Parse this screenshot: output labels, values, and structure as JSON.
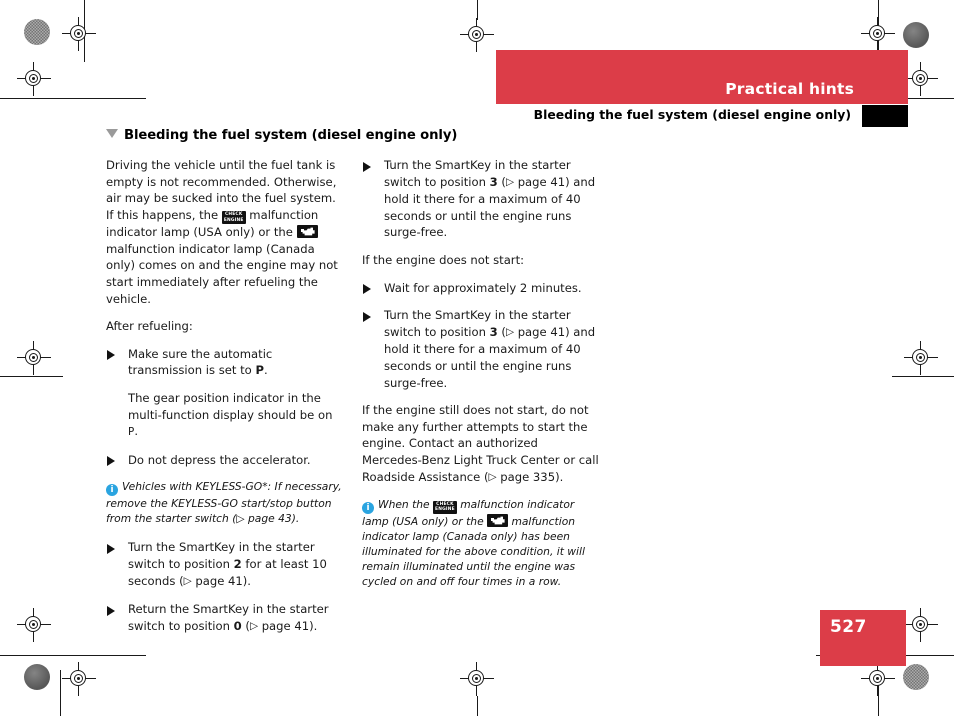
{
  "colors": {
    "brand_red": "#dc3d48",
    "info_blue": "#2aa4e0",
    "black": "#000000"
  },
  "header": {
    "banner_title": "Practical hints",
    "running_header": "Bleeding the fuel system (diesel engine only)"
  },
  "footer": {
    "page_number": "527"
  },
  "section": {
    "heading": "Bleeding the fuel system (diesel engine only)"
  },
  "icons": {
    "check_engine_line1": "CHECK",
    "check_engine_line2": "ENGINE",
    "info": "i",
    "section_marker": "triangle-down-icon",
    "bullet_marker": "triangle-right-icon"
  },
  "left_column": {
    "intro_1": "Driving the vehicle until the fuel tank is empty is not recommended. Otherwise, air may be sucked into the fuel system. If this happens, the ",
    "intro_2": " malfunction indicator lamp (USA only) or the ",
    "intro_3": " malfunction indicator lamp (Canada only) comes on and the engine may not start immediately after refueling the vehicle.",
    "after_refueling_label": "After refueling:",
    "bullet_1": "Make sure the automatic transmission is set to P.",
    "bullet_1_sub": "The gear position indicator in the multi-function display should be on P.",
    "bullet_2": "Do not depress the accelerator.",
    "note": "Vehicles with KEYLESS-GO*: If necessary, remove the KEYLESS-GO start/stop button from the starter switch (▷ page 43).",
    "bullet_3": "Turn the SmartKey in the starter switch to position 2 for at least 10 seconds (▷ page 41).",
    "bullet_4": "Return the SmartKey in the starter switch to position 0 (▷ page 41)."
  },
  "right_column": {
    "bullet_1": "Turn the SmartKey in the starter switch to position 3 (▷ page 41) and hold it there for a maximum of 40 seconds or until the engine runs surge-free.",
    "does_not_start_label": "If the engine does not start:",
    "bullet_2": "Wait for approximately 2 minutes.",
    "bullet_3": "Turn the SmartKey in the starter switch to position 3 (▷ page 41) and hold it there for a maximum of 40 seconds or until the engine runs surge-free.",
    "paragraph": "If the engine still does not start, do not make any further attempts to start the engine. Contact an authorized Mercedes-Benz Light Truck Center or call Roadside Assistance (▷ page 335).",
    "note_1": "When the ",
    "note_2": " malfunction indicator lamp (USA only) or the ",
    "note_3": " malfunction indicator lamp (Canada only) has been illuminated for the above condition, it will remain illuminated until the engine was cycled on and off four times in a row."
  }
}
